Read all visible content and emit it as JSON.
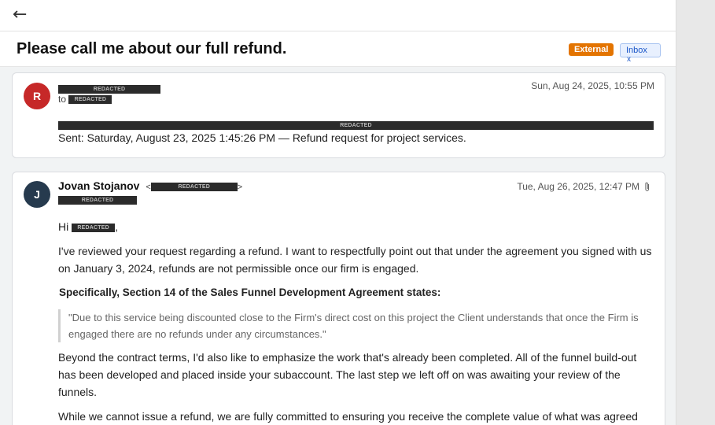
{
  "header": {
    "back_icon": "←",
    "subject": "Please call me about our full refund.",
    "badge_external": "External",
    "badge_inbox": "Inbox",
    "badge_inbox_close": "x"
  },
  "redacted_label": "REDACTED",
  "message1": {
    "avatar_letter": "R",
    "avatar_color": "#c62828",
    "to_prefix": "to",
    "date": "Sun, Aug 24, 2025, 10:55 PM",
    "sent_line": "Sent: Saturday, August 23, 2025 1:45:26 PM — Refund request for project services."
  },
  "message2": {
    "avatar_letter": "J",
    "avatar_color": "#263a4e",
    "sender_name": "Jovan Stojanov",
    "email_open": "<",
    "email_close": ">",
    "date": "Tue, Aug 26, 2025, 12:47 PM",
    "attachment_icon": "paperclip-icon",
    "greeting_prefix": "Hi",
    "greeting_suffix": ",",
    "para1": "I've reviewed your request regarding a refund. I want to respectfully point out that under the agreement you signed with us on January 3, 2024, refunds are not permissible once our firm is engaged.",
    "section_heading": "Specifically, Section 14 of the Sales Funnel Development Agreement states:",
    "quote": "\"Due to this service being discounted close to the Firm's direct cost on this project the Client understands that once the Firm is engaged there are no refunds under any circumstances.\"",
    "para2": "Beyond the contract terms, I'd also like to emphasize the work that's already been completed. All of the funnel build-out has been developed and placed inside your subaccount. The last step we left off on was awaiting your review of the funnels.",
    "para3": "While we cannot issue a refund, we are fully committed to ensuring you receive the complete value of what was agreed upon. If you'd like, we can set up a call or walkthrough to go over the funnels together."
  }
}
